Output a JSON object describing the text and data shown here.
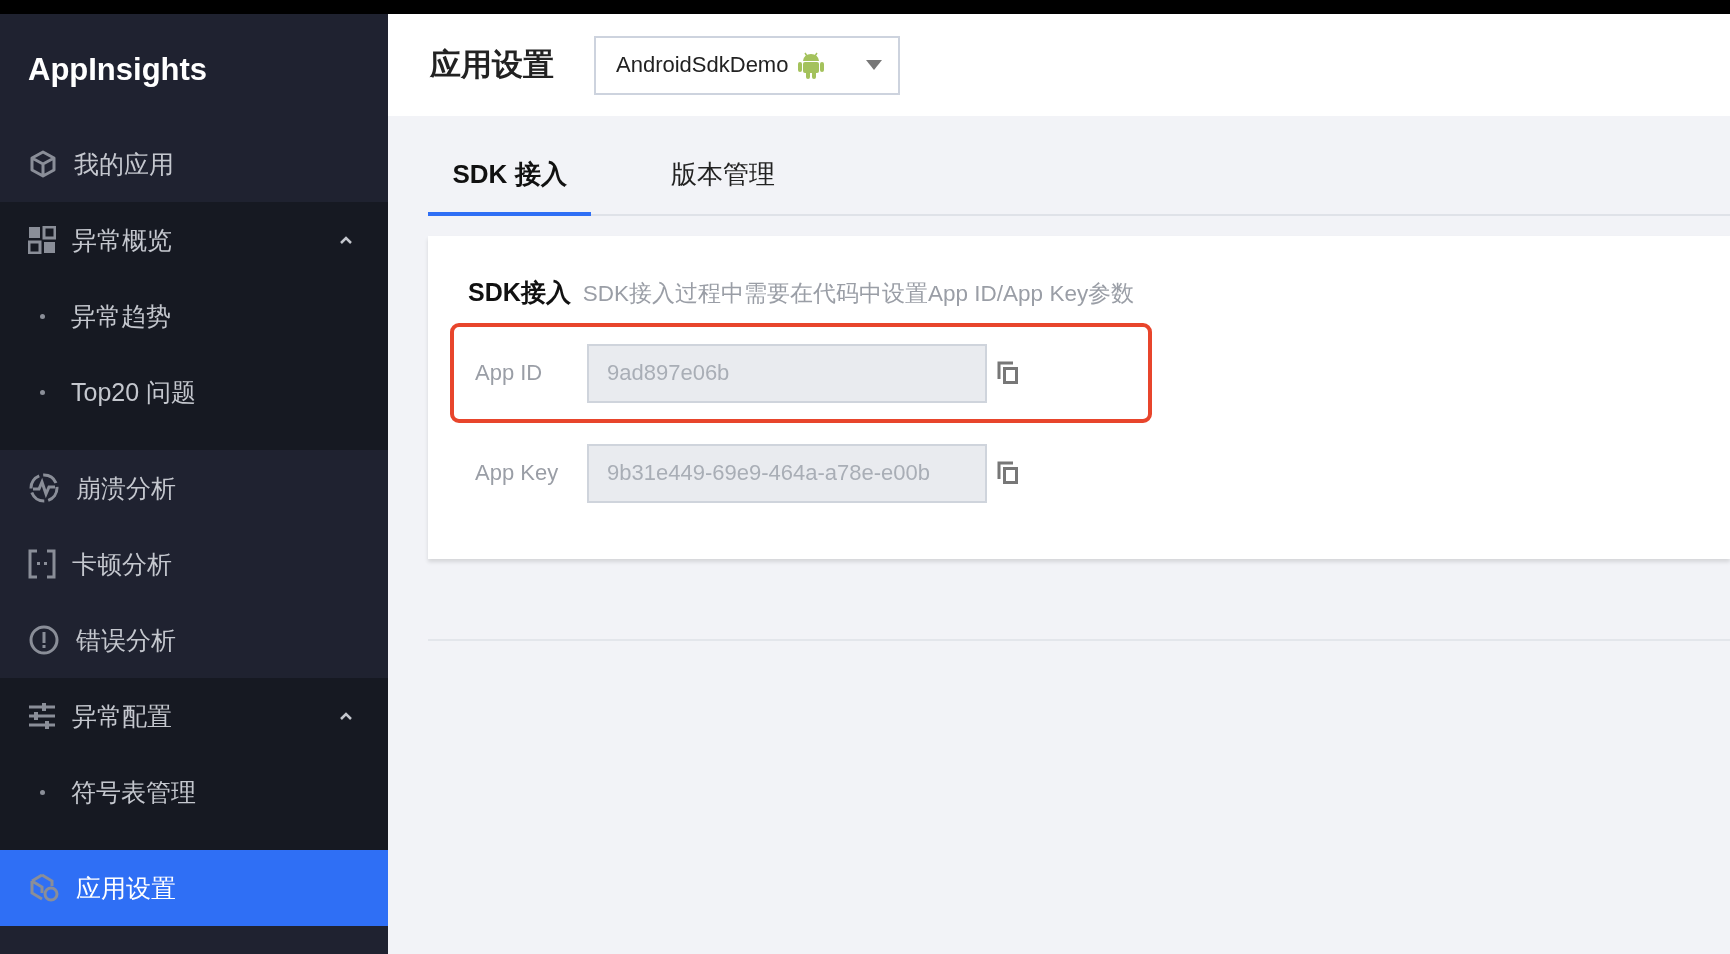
{
  "sidebar": {
    "logo": "AppInsights",
    "items": [
      {
        "label": "我的应用",
        "selected": false
      },
      {
        "label": "异常概览",
        "selected": false,
        "expanded": true,
        "children": [
          {
            "label": "异常趋势",
            "selected": false
          },
          {
            "label": "Top20 问题",
            "selected": false
          }
        ]
      },
      {
        "label": "崩溃分析",
        "selected": false
      },
      {
        "label": "卡顿分析",
        "selected": false
      },
      {
        "label": "错误分析",
        "selected": false
      },
      {
        "label": "异常配置",
        "selected": false,
        "expanded": true,
        "children": [
          {
            "label": "符号表管理",
            "selected": false
          }
        ]
      },
      {
        "label": "应用设置",
        "selected": true
      }
    ]
  },
  "header": {
    "title": "应用设置",
    "app_select": {
      "value": "AndroidSdkDemo"
    }
  },
  "tabs": [
    {
      "label": "SDK 接入",
      "selected": true
    },
    {
      "label": "版本管理",
      "selected": false
    }
  ],
  "sdk_card": {
    "title": "SDK接入",
    "description": "SDK接入过程中需要在代码中设置App ID/App Key参数",
    "fields": [
      {
        "label": "App ID",
        "value": "9ad897e06b",
        "disabled": true,
        "highlighted": true
      },
      {
        "label": "App Key",
        "value": "9b31e449-69e9-464a-a78e-e00b",
        "disabled": true,
        "highlighted": false
      }
    ]
  }
}
